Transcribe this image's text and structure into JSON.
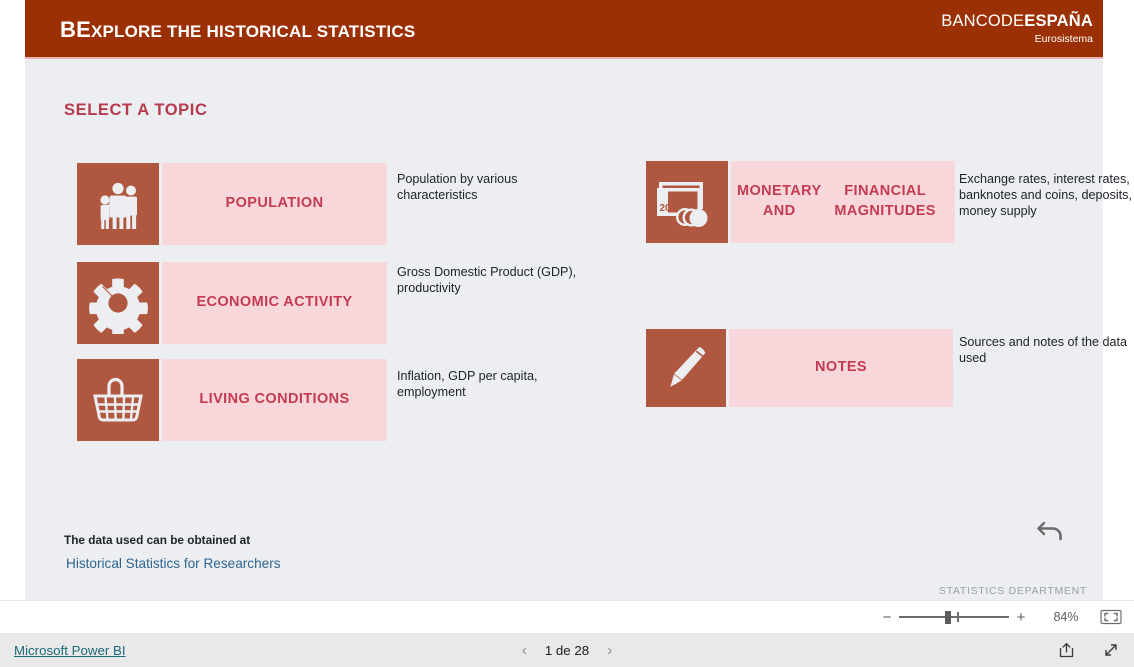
{
  "report": {
    "header": {
      "title_prefix": "BE",
      "title_rest": "XPLORE THE HISTORICAL STATISTICS",
      "logo_thin": "BANCODE",
      "logo_bold": "ESPAÑA",
      "logo_sub": "Eurosistema",
      "bg_color": "#9c3005"
    },
    "section_title": "SELECT A TOPIC",
    "tiles": [
      {
        "id": "population",
        "icon": "family-icon",
        "label": "POPULATION",
        "desc": "Population by various characteristics"
      },
      {
        "id": "economic",
        "icon": "gear-icon",
        "label": "ECONOMIC ACTIVITY",
        "desc": "Gross Domestic Product (GDP), productivity"
      },
      {
        "id": "living",
        "icon": "shopping-basket-icon",
        "label": "LIVING CONDITIONS",
        "desc": "Inflation, GDP per capita, employment"
      },
      {
        "id": "monetary",
        "icon": "banknotes-coins-icon",
        "label": "MONETARY AND FINANCIAL MAGNITUDES",
        "label_line1": "MONETARY AND",
        "label_line2": "FINANCIAL MAGNITUDES",
        "desc": "Exchange rates, interest rates, banknotes and coins, deposits, money supply"
      },
      {
        "id": "notes",
        "icon": "pen-icon",
        "label": "NOTES",
        "desc": "Sources and notes of the data used"
      }
    ],
    "footer": {
      "data_note": "The data used can be obtained at",
      "data_link": "Historical Statistics for Researchers",
      "department": "STATISTICS DEPARTMENT",
      "back_icon": "back-arrow-icon"
    },
    "colors": {
      "tile_icon_bg": "#b0573f",
      "tile_label_bg": "#f7d7d9",
      "tile_label_text": "#c43b52",
      "canvas_bg": "#eceef2",
      "section_title": "#b63b4d",
      "link": "#2e6590"
    }
  },
  "zoombar": {
    "minus_label": "−",
    "plus_label": "+",
    "zoom_percent": "84%",
    "fit_icon": "fit-to-page-icon"
  },
  "statusbar": {
    "brand": "Microsoft Power BI",
    "prev_icon": "chevron-left-icon",
    "next_icon": "chevron-right-icon",
    "page_indicator": "1 de 28",
    "share_icon": "share-icon",
    "fullscreen_icon": "fullscreen-icon"
  }
}
